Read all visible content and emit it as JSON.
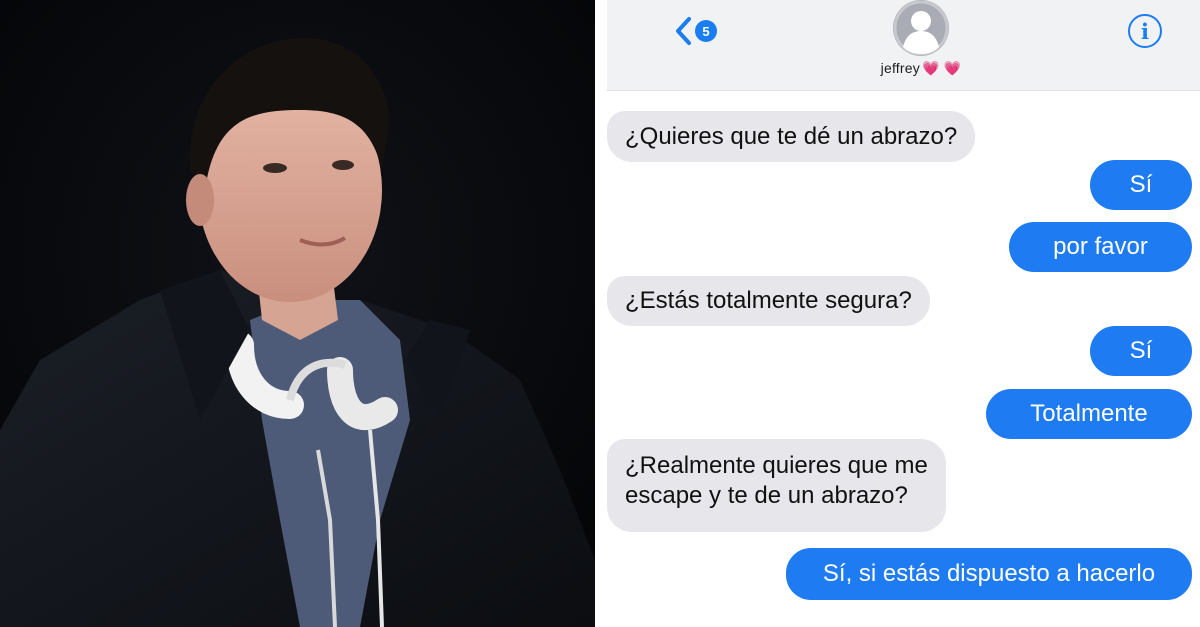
{
  "header": {
    "back_count": "5",
    "contact_name": "jeffrey",
    "contact_emoji": "💗 💗"
  },
  "messages": [
    {
      "from": "contact",
      "text": "¿Quieres que te dé un abrazo?"
    },
    {
      "from": "me",
      "text": "Sí"
    },
    {
      "from": "me",
      "text": "por favor"
    },
    {
      "from": "contact",
      "text": "¿Estás totalmente segura?"
    },
    {
      "from": "me",
      "text": "Sí"
    },
    {
      "from": "me",
      "text": "Totalmente"
    },
    {
      "from": "contact",
      "lines": [
        "¿Realmente quieres que me",
        "escape y te de un abrazo?"
      ]
    },
    {
      "from": "me",
      "text": "Sí, si estás dispuesto a hacerlo"
    }
  ],
  "colors": {
    "incoming_bubble": "#e6e6eb",
    "outgoing_bubble": "#1f7bf2",
    "accent": "#1a7ef2"
  },
  "icons": [
    "back-chevron-icon",
    "unread-count-badge",
    "contact-avatar-icon",
    "info-icon"
  ]
}
